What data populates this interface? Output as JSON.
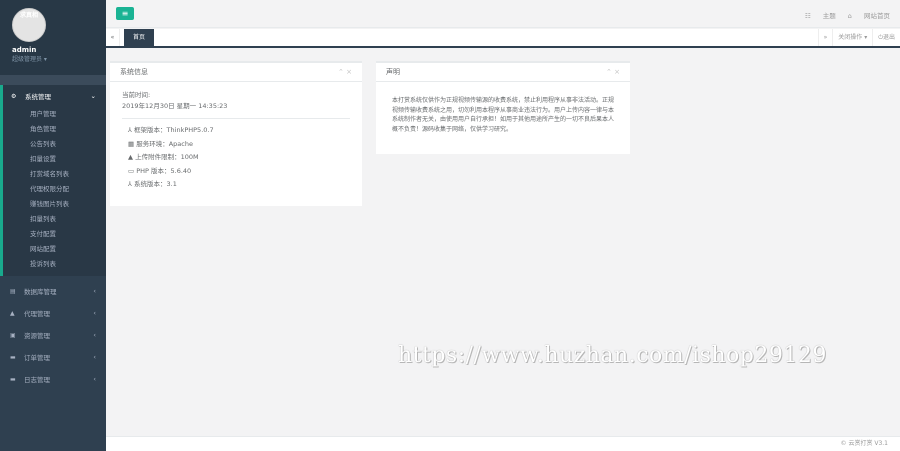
{
  "user": {
    "avatar_text": "求真相",
    "name": "admin",
    "role": "超级管理员"
  },
  "sidebar": {
    "open_section": "系统管理",
    "items": [
      "用户管理",
      "角色管理",
      "公告列表",
      "扣量设置",
      "打赏域名列表",
      "代理权限分配",
      "赚钱图片列表",
      "扣量列表",
      "支付配置",
      "网站配置",
      "投诉列表"
    ],
    "sections": [
      "数据库管理",
      "代理管理",
      "资源管理",
      "订单管理",
      "日志管理"
    ]
  },
  "header": {
    "theme": "主题",
    "home": "网站首页"
  },
  "tabs": {
    "home": "首页",
    "close_ops": "关闭操作",
    "logout": "退出"
  },
  "system": {
    "title": "系统信息",
    "time_label": "当前时间:",
    "time": "2019年12月30日 星期一 14:35:23",
    "rows": [
      "框架版本：ThinkPHP5.0.7",
      "服务环境：Apache",
      "上传附件限制：100M",
      "PHP 版本：5.6.40",
      "系统版本：3.1"
    ]
  },
  "notice": {
    "title": "声明",
    "text": "本打赏系统仅供作为正规视频传输源的收费系统，禁止利用程序从事非法活动。正规视频传输收费系统之用，切勿利用本程序从事商业违法行为。用户上传内容一律与本系统制作者无关，由使用用户自行承担！如用于其他用途所产生的一切不良后果本人概不负责！源码收集于网络，仅供学习研究。"
  },
  "watermark": "https://www.huzhan.com/ishop29129",
  "footer": "© 云赏打赏 V3.1"
}
